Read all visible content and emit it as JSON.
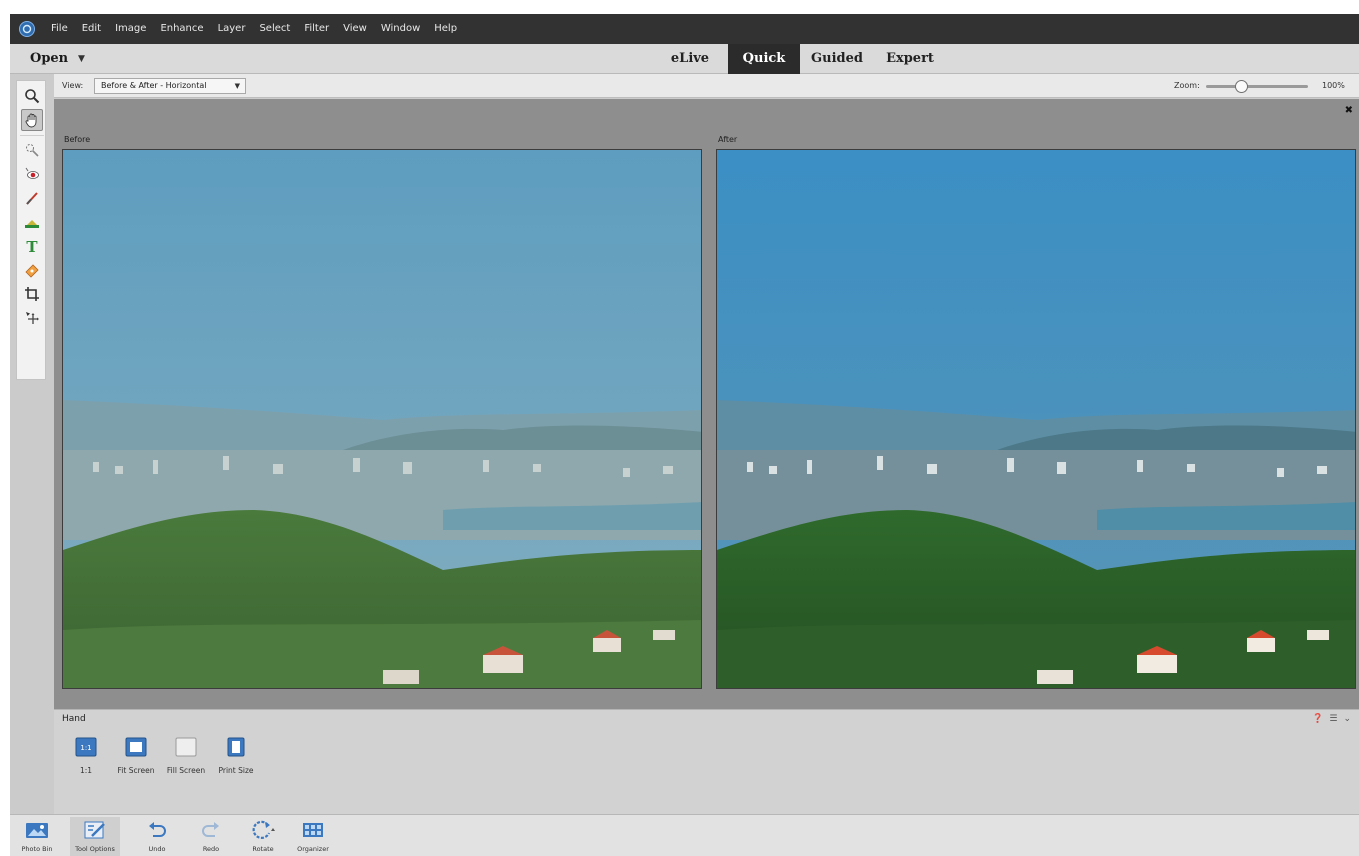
{
  "menubar": {
    "items": [
      "File",
      "Edit",
      "Image",
      "Enhance",
      "Layer",
      "Select",
      "Filter",
      "View",
      "Window",
      "Help"
    ]
  },
  "modebar": {
    "open_label": "Open",
    "tabs": [
      {
        "label": "eLive"
      },
      {
        "label": "Quick",
        "active": true
      },
      {
        "label": "Guided"
      },
      {
        "label": "Expert"
      }
    ]
  },
  "viewbar": {
    "view_label": "View:",
    "view_value": "Before & After - Horizontal",
    "zoom_label": "Zoom:",
    "zoom_value": "100%",
    "zoom_level": 0.35
  },
  "toolbox": {
    "tools": [
      "zoom-tool-icon",
      "hand-tool-icon",
      "quick-selection-icon",
      "red-eye-icon",
      "whiten-teeth-icon",
      "straighten-icon",
      "type-tool-icon",
      "spot-healing-icon",
      "crop-tool-icon",
      "move-tool-icon"
    ],
    "selected": "hand-tool-icon"
  },
  "canvas": {
    "before_label": "Before",
    "after_label": "After"
  },
  "tool_options": {
    "tool_name": "Hand",
    "buttons": [
      {
        "label": "1:1",
        "icon": "actual-pixels-icon"
      },
      {
        "label": "Fit Screen",
        "icon": "fit-screen-icon"
      },
      {
        "label": "Fill Screen",
        "icon": "fill-screen-icon"
      },
      {
        "label": "Print Size",
        "icon": "print-size-icon"
      }
    ],
    "actual_pixels_text": "1:1"
  },
  "taskbar": {
    "buttons": [
      {
        "label": "Photo Bin",
        "icon": "photo-bin-icon"
      },
      {
        "label": "Tool Options",
        "icon": "tool-options-icon",
        "active": true
      },
      {
        "label": "Undo",
        "icon": "undo-icon"
      },
      {
        "label": "Redo",
        "icon": "redo-icon"
      },
      {
        "label": "Rotate",
        "icon": "rotate-icon"
      },
      {
        "label": "Organizer",
        "icon": "organizer-icon"
      }
    ]
  },
  "colors": {
    "menubar_bg": "#323232",
    "active_tab_bg": "#2b2b2b",
    "accent_blue": "#3b78c0"
  }
}
